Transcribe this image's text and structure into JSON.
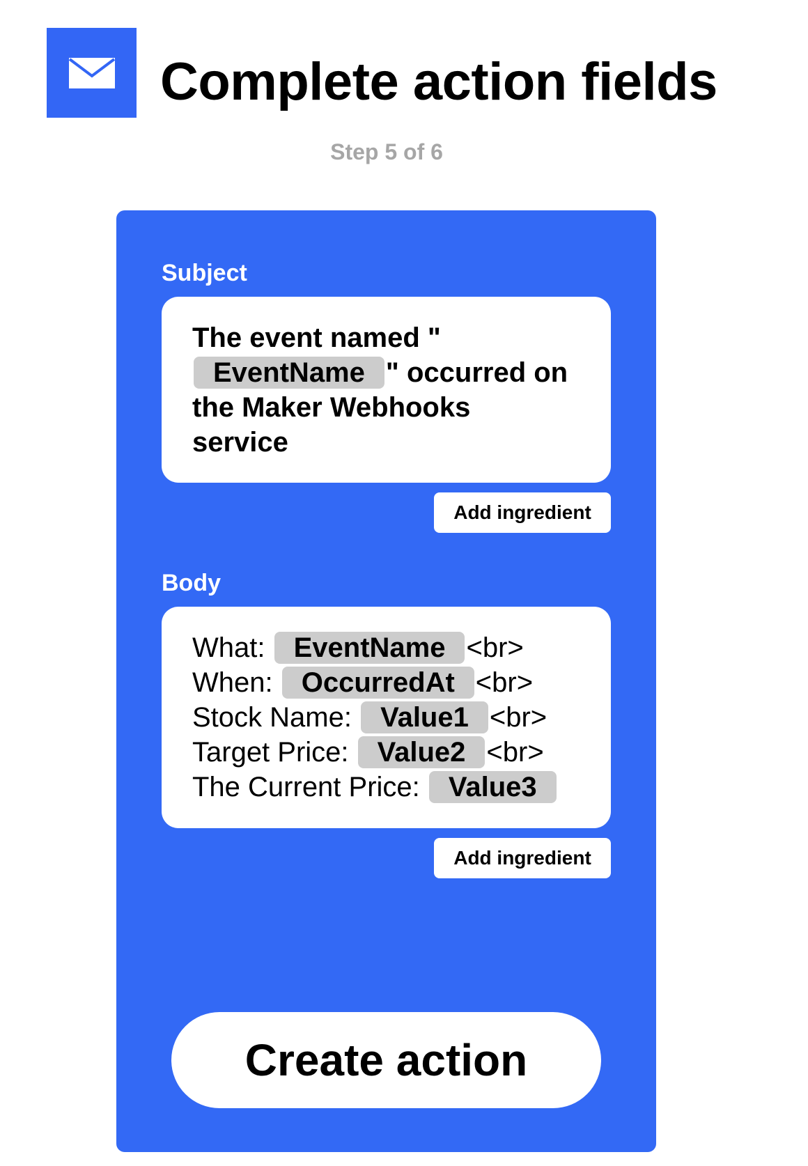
{
  "header": {
    "icon": "email-icon",
    "title": "Complete action fields",
    "step": "Step 5 of 6"
  },
  "colors": {
    "accent": "#3369f5",
    "pill": "#cccccc",
    "step_text": "#a6a6a6"
  },
  "subject": {
    "label": "Subject",
    "text_before": "The event named \"",
    "ingredient": "EventName",
    "text_after_1": "\" occurred on",
    "text_after_2": "the Maker Webhooks",
    "text_after_3": "service",
    "add_label": "Add ingredient"
  },
  "body": {
    "label": "Body",
    "rows": [
      {
        "label": "What:",
        "ingredient": "EventName",
        "suffix": "<br>"
      },
      {
        "label": "When:",
        "ingredient": "OccurredAt",
        "suffix": "<br>"
      },
      {
        "label": "Stock Name:",
        "ingredient": "Value1",
        "suffix": "<br>"
      },
      {
        "label": "Target Price:",
        "ingredient": "Value2",
        "suffix": "<br>"
      },
      {
        "label": "The Current Price:",
        "ingredient": "Value3",
        "suffix": ""
      }
    ],
    "add_label": "Add ingredient"
  },
  "create_label": "Create action"
}
